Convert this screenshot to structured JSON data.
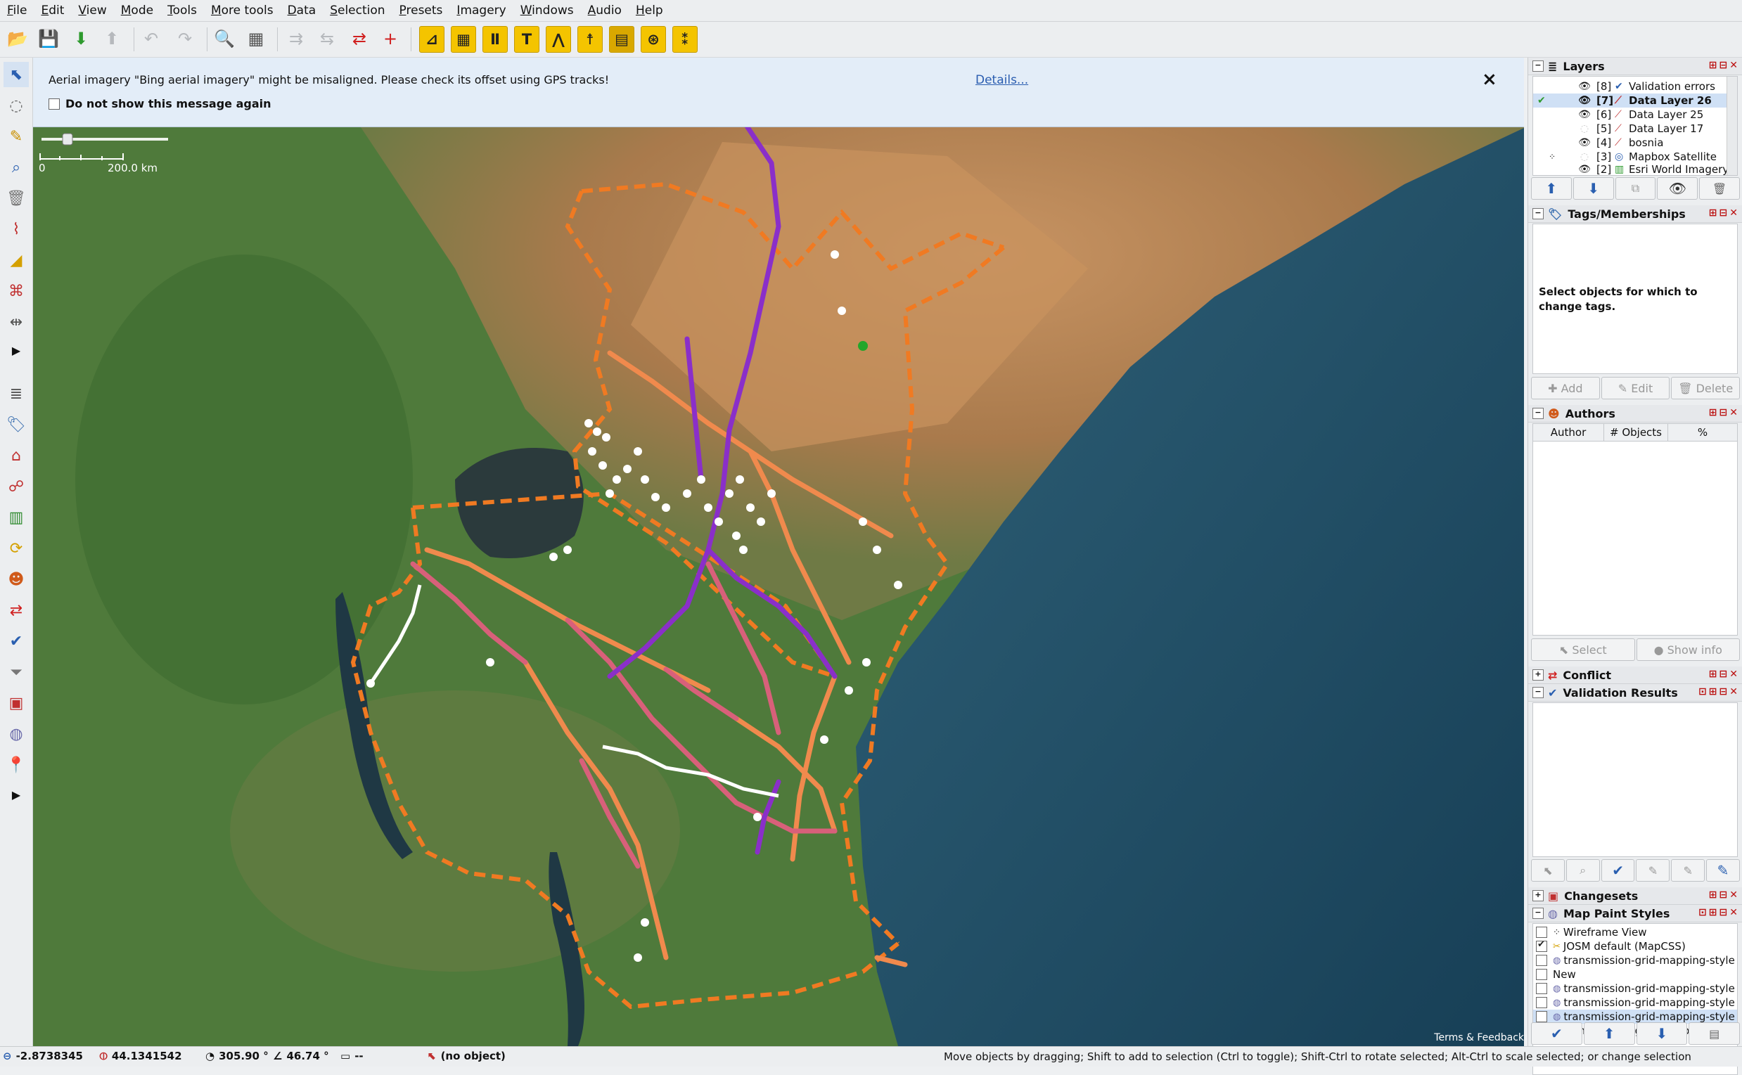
{
  "menu": [
    "File",
    "Edit",
    "View",
    "Mode",
    "Tools",
    "More tools",
    "Data",
    "Selection",
    "Presets",
    "Imagery",
    "Windows",
    "Audio",
    "Help"
  ],
  "toolbar_icons": [
    "open-icon",
    "save-icon",
    "download-icon",
    "upload-icon",
    "undo-icon",
    "redo-icon",
    "zoom-icon",
    "preferences-icon",
    "merge-icon",
    "split-icon",
    "reverse-icon",
    "add-node-icon",
    "preset-pole-icon",
    "preset-substation-icon",
    "preset-tower-icon",
    "preset-portal-icon",
    "preset-line-icon",
    "preset-transformer-icon",
    "preset-plant-icon",
    "preset-generator-icon",
    "preset-insulator-icon"
  ],
  "notice": {
    "message": "Aerial imagery \"Bing aerial imagery\" might be misaligned. Please check its offset using GPS tracks!",
    "details_link": "Details...",
    "close": "×",
    "checkbox_label": "Do not show this message again"
  },
  "map": {
    "scale_zero": "0",
    "scale_label": "200.0 km",
    "terms": "Terms & Feedback",
    "colors": {
      "land": "#4f7a3b",
      "savanna": "#b58252",
      "ocean": "#27536c",
      "lake": "#2b3a3c",
      "border": "#f07a22",
      "line_orange": "#f08a4d",
      "line_pink": "#d8607a",
      "line_purple": "#8a2fc9",
      "node": "#ffffff"
    }
  },
  "layers": {
    "title": "Layers",
    "items": [
      {
        "num": "[8]",
        "name": "Validation errors",
        "visible": true,
        "selected": false
      },
      {
        "num": "[7]",
        "name": "Data Layer 26",
        "visible": true,
        "selected": true
      },
      {
        "num": "[6]",
        "name": "Data Layer 25",
        "visible": true,
        "selected": false
      },
      {
        "num": "[5]",
        "name": "Data Layer 17",
        "visible": false,
        "selected": false
      },
      {
        "num": "[4]",
        "name": "bosnia",
        "visible": true,
        "selected": false
      },
      {
        "num": "[3]",
        "name": "Mapbox Satellite",
        "visible": false,
        "selected": false
      },
      {
        "num": "[2]",
        "name": "Esri World Imagery",
        "visible": true,
        "selected": false
      }
    ]
  },
  "tags": {
    "title": "Tags/Memberships",
    "empty_message": "Select objects for which to change tags.",
    "add": "Add",
    "edit": "Edit",
    "delete": "Delete"
  },
  "authors": {
    "title": "Authors",
    "col_author": "Author",
    "col_objects": "# Objects",
    "col_percent": "%",
    "select": "Select",
    "show_info": "Show info"
  },
  "conflict": {
    "title": "Conflict"
  },
  "validation": {
    "title": "Validation Results"
  },
  "changesets": {
    "title": "Changesets"
  },
  "paint_styles": {
    "title": "Map Paint Styles",
    "items": [
      {
        "name": "Wireframe View",
        "checked": false,
        "selected": false
      },
      {
        "name": "JOSM default (MapCSS)",
        "checked": true,
        "selected": false
      },
      {
        "name": "transmission-grid-mapping-style",
        "checked": false,
        "selected": false
      },
      {
        "name": "New",
        "checked": false,
        "selected": false
      },
      {
        "name": "transmission-grid-mapping-style",
        "checked": false,
        "selected": false
      },
      {
        "name": "transmission-grid-mapping-style",
        "checked": false,
        "selected": false
      },
      {
        "name": "transmission-grid-mapping-style",
        "checked": false,
        "selected": true
      },
      {
        "name": "transmission-grid-mapping-style",
        "checked": true,
        "selected": false
      }
    ]
  },
  "status": {
    "lat": "-2.8738345",
    "lon": "44.1341542",
    "heading": "305.90 °",
    "angle": "46.74 °",
    "length": "--",
    "object": "(no object)",
    "hint": "Move objects by dragging; Shift to add to selection (Ctrl to toggle); Shift-Ctrl to rotate selected; Alt-Ctrl to scale selected; or change selection"
  }
}
